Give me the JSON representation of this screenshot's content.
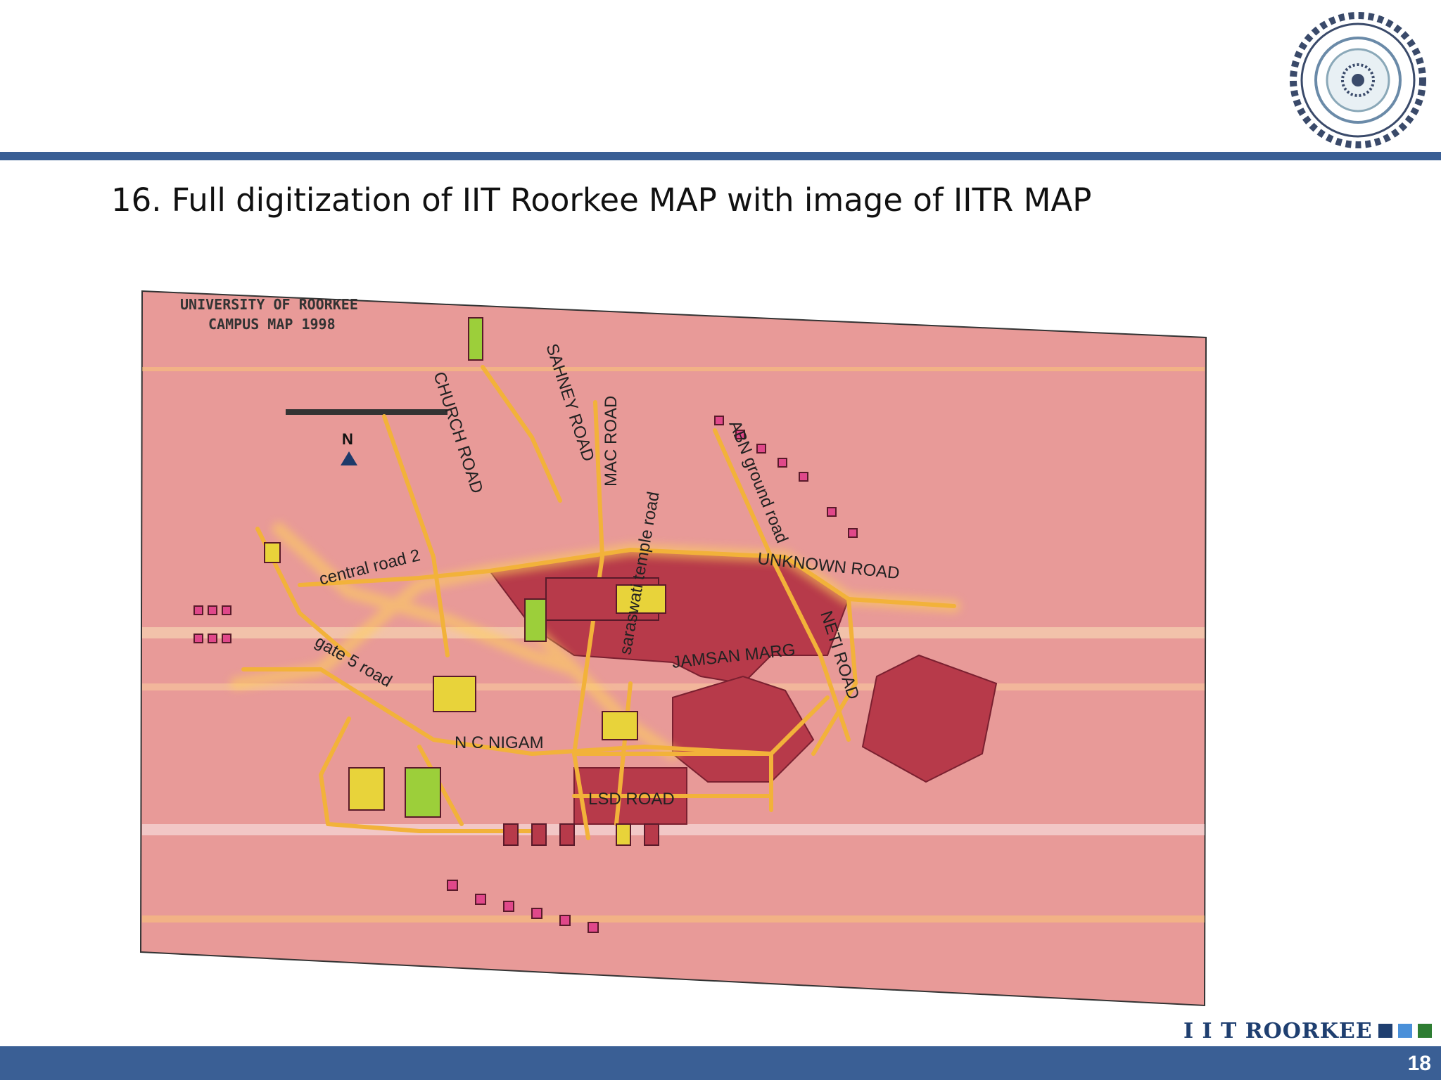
{
  "slide": {
    "title": "16. Full digitization of IIT Roorkee MAP with image of IITR MAP",
    "page_number": "18"
  },
  "brand": {
    "logo_icon": "iit-roorkee-seal-icon",
    "logo_text": "IIT ROORKEE",
    "text": "I I T ROORKEE",
    "colors": {
      "rule": "#3a5f95",
      "text": "#1f3f70",
      "squares": [
        "#1f3f70",
        "#4a90d9",
        "#2e7d32"
      ]
    }
  },
  "map": {
    "heading_line1": "UNIVERSITY OF ROORKEE",
    "heading_line2": "CAMPUS MAP 1998",
    "north": "N",
    "road_labels": [
      "CHURCH ROAD",
      "SAHNEY ROAD",
      "MAC ROAD",
      "ABN ground road",
      "UNKNOWN ROAD",
      "central road 2",
      "saraswati temple road",
      "JAMSAN MARG",
      "NETI ROAD",
      "gate 5 road",
      "N C NIGAM",
      "LSD ROAD"
    ],
    "colors": {
      "background": "#e89a98",
      "road": "#f2b23a",
      "building": "#b73a4a",
      "building_pink": "#e0488a",
      "green": "#9ccf3a",
      "yellow": "#e8d33a"
    }
  }
}
